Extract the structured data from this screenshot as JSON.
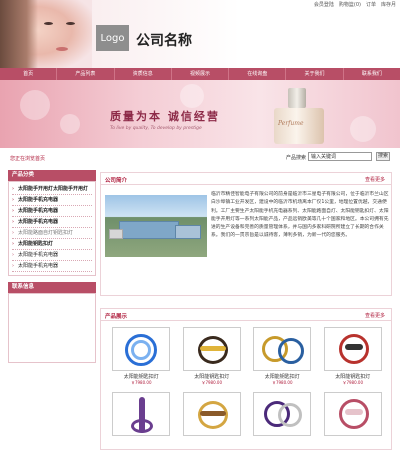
{
  "header": {
    "logo_text": "Logo",
    "company_name": "公司名称",
    "top_links": [
      "会员登陆",
      "购物篮(0)",
      "订单",
      "库存月"
    ]
  },
  "nav": {
    "items": [
      "首页",
      "产品列表",
      "资质信息",
      "视频展示",
      "在线询盘",
      "关于我们",
      "联系我们"
    ]
  },
  "banner": {
    "title": "质量为本   诚信经营",
    "subtitle": "To live by quality, To develop by prestige",
    "bottle_label": "Perfume"
  },
  "notice": {
    "text": "您正在浏览首页"
  },
  "search": {
    "label": "产品搜索",
    "placeholder": "输入关键词",
    "button_label": "搜索"
  },
  "sidebar": {
    "category_title": "产品分类",
    "items": [
      {
        "label": "太阳能手开用灯太阳能手开用灯",
        "bold": true,
        "muted": false
      },
      {
        "label": "太阳能手机充电器",
        "bold": true,
        "muted": false
      },
      {
        "label": "太阳能手机充电器",
        "bold": true,
        "muted": false
      },
      {
        "label": "太阳能手机充电器",
        "bold": true,
        "muted": false
      },
      {
        "label": "太阳能路面自灯钥匙扣灯",
        "bold": false,
        "muted": true
      },
      {
        "label": "太阳能钥匙扣灯",
        "bold": true,
        "muted": false
      },
      {
        "label": "太阳能手机充电器",
        "bold": false,
        "muted": false
      },
      {
        "label": "太阳能手机充电器",
        "bold": false,
        "muted": false
      }
    ],
    "contact_title": "联系信息"
  },
  "intro": {
    "title": "公司简介",
    "more": "查看更多",
    "text": "临沂市精佳智能电子有限公司的前身是临沂市三星电子有限公司，位于临沂市兰山区白沙埠镇工业开发区，建设中的临沂市机场离本厂仅1公里，地理位置优越，交通便利。工厂主要生产太阳能手机充电器系列、太阳能路面自灯、太阳能钥匙扣灯、太阳能手开用灯等一系列太阳能产品，产品远销欧美等几十个国家和地区。本公司拥有先进的生产设备和完善的质量管理体系，并与国内多家科研院所建立了长期的合作关系。我们的一贯宗旨是以诚待客，薄利多销，为新一代的您服务。"
  },
  "products": {
    "title": "产品展示",
    "more": "查看更多",
    "items": [
      {
        "name": "太阳能钥匙扣灯",
        "price": "￥7980.00",
        "color": "#2a6fd6"
      },
      {
        "name": "太阳能钥匙扣灯",
        "price": "￥7980.00",
        "color": "#3a2a1e"
      },
      {
        "name": "太阳能钥匙扣灯",
        "price": "￥7980.00",
        "color": "#c79a2b"
      },
      {
        "name": "太阳能钥匙扣灯",
        "price": "￥7980.00",
        "color": "#b8322d"
      },
      {
        "name": "",
        "price": "",
        "color": "#6a3e8f"
      },
      {
        "name": "",
        "price": "",
        "color": "#d4a642"
      },
      {
        "name": "",
        "price": "",
        "color": "#4b2a7a"
      },
      {
        "name": "",
        "price": "",
        "color": "#b84e66"
      }
    ]
  },
  "colors": {
    "accent": "#b84e66",
    "title_red": "#b0203f"
  }
}
